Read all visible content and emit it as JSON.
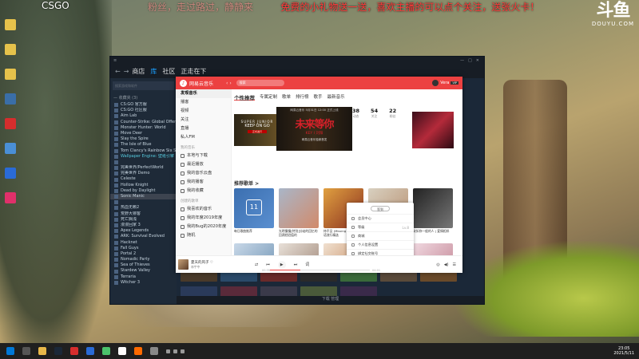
{
  "overlay": {
    "game": "CSGO",
    "marquee_faded": "粉丝，走过路过，静静来",
    "marquee": "免费的小礼物送一送，喜欢主播的可以点个关注，送张火卡！",
    "watermark_big": "斗鱼",
    "watermark_small": "DOUYU.COM"
  },
  "desktop_icons": [
    {
      "label": "",
      "color": "#e6c24b"
    },
    {
      "label": "",
      "color": "#e6c24b"
    },
    {
      "label": "",
      "color": "#e6c24b"
    },
    {
      "label": "",
      "color": "#3a6ea8"
    },
    {
      "label": "",
      "color": "#d62d2d"
    },
    {
      "label": "",
      "color": "#4a8fd6"
    },
    {
      "label": "",
      "color": "#2a6bd6"
    },
    {
      "label": "",
      "color": "#e0306a"
    }
  ],
  "steam": {
    "nav_items": [
      "商店",
      "库",
      "社区",
      "正走在下"
    ],
    "search_placeholder": "搜索游戏和软件",
    "group_label": "— 收藏夹 (3)",
    "games": [
      "CS:GO 官方服",
      "CS:GO 社区服",
      "Aim Lab",
      "Counter-Strike: Global Offensive",
      "Monster Hunter: World",
      "Move Deer",
      "Slay the Spire",
      "The Isle of Blue",
      "Tom Clancy's Rainbow Six Siege",
      "Wallpaper Engine: 壁纸引擎",
      "",
      "完美世界/PerfectWorld",
      "完美世界 Demo",
      "Celeste",
      "Hollow Knight",
      "Dead by Daylight",
      "Sonic Manic",
      "",
      "热血无赖2",
      "荒野大镖客",
      "死亡搁浅",
      "漫漫回家 3",
      "Apex Legends",
      "ARK: Survival Evolved",
      "Hacknet",
      "Fall Guys",
      "Portal 2",
      "Nomadic Party",
      "Sea of Thieves",
      "Stardew Valley",
      "Terraria",
      "Witcher 3"
    ],
    "bottom_text": "下载\n管理"
  },
  "netease": {
    "app_name": "网易云音乐",
    "search_placeholder": "搜索",
    "username": "Vera",
    "vip_badge": "VIP",
    "sidebar": {
      "items": [
        "发现音乐",
        "播客",
        "视频",
        "关注",
        "直播",
        "私人FM"
      ],
      "section_my": "我的音乐",
      "my_items": [
        "本地与下载",
        "最近播放",
        "我的音乐云盘",
        "我的播客",
        "我的收藏"
      ],
      "section_playlist": "创建的歌单",
      "playlist_items": [
        "我喜欢的音乐",
        "我的年度2019年度",
        "我的Bug的2020年度",
        "随机"
      ]
    },
    "tabs": [
      "个性推荐",
      "专属定制",
      "歌单",
      "排行榜",
      "歌手",
      "最新音乐"
    ],
    "banner": {
      "left_line1": "SUPER JUNIOR",
      "left_line2": "KEEP ON GO",
      "left_line3": "正式发行",
      "center_top": "网易云音乐 5月31日 12:00 正式上线",
      "center_big": "未来等你",
      "center_sub": "KEY I 刘阳",
      "center_bottom": "网易云音乐独家首发"
    },
    "stats": [
      {
        "n": "38",
        "l": "动态"
      },
      {
        "n": "54",
        "l": "关注"
      },
      {
        "n": "22",
        "l": "粉丝"
      }
    ],
    "menu": {
      "signin": "签到",
      "items": [
        {
          "label": "会员中心",
          "value": ""
        },
        {
          "label": "等级",
          "value": "Lv.8"
        },
        {
          "label": "商城",
          "value": ""
        },
        {
          "label": "个人信息设置",
          "value": ""
        },
        {
          "label": "绑定社交账号",
          "value": ""
        },
        {
          "label": "我的客服",
          "value": ""
        },
        {
          "label": "退出登录",
          "value": ""
        }
      ]
    },
    "section_title": "推荐歌单 >",
    "playlists": [
      {
        "caption": "每日歌曲推荐",
        "c1": "#3b6fb0",
        "c2": "#5a8fd0",
        "day": "11"
      },
      {
        "caption": "光明慢慢[特别]分歧的回忆的回溯经验值的",
        "c1": "#a9b6c8",
        "c2": "#d28a6a",
        "day": ""
      },
      {
        "caption": "待不见 (Missing Lights) 华语流行精选",
        "c1": "#e0a040",
        "c2": "#8a3020",
        "day": ""
      },
      {
        "caption": "4所有被遗忘的 | 每一首都是你的回忆",
        "c1": "#d8d0c0",
        "c2": "#b89070",
        "day": ""
      },
      {
        "caption": "致如你一般的人 | 爱情相伴",
        "c1": "#222222",
        "c2": "#777777",
        "day": ""
      },
      {
        "caption": "",
        "c1": "#c8d8e8",
        "c2": "#6a8fb0",
        "day": ""
      },
      {
        "caption": "",
        "c1": "#e8e0d8",
        "c2": "#9a8070",
        "day": ""
      },
      {
        "caption": "",
        "c1": "#f0e0d0",
        "c2": "#c08050",
        "day": ""
      },
      {
        "caption": "",
        "c1": "#a0d0e0",
        "c2": "#ffffff",
        "day": ""
      },
      {
        "caption": "",
        "c1": "#f0d8e0",
        "c2": "#c08090",
        "day": ""
      }
    ],
    "player": {
      "song": "夏天的风子 ♡",
      "artist": "林宇中",
      "time_cur": "00:35",
      "time_total": "04:01"
    }
  },
  "taskbar": {
    "icons": [
      "#0078d7",
      "#555555",
      "#e8b84a",
      "#1b2838",
      "#d62d2d",
      "#2a6bd6",
      "#4ac26b",
      "#ffffff",
      "#ff6a00",
      "#888888"
    ],
    "time": "23:05",
    "date": "2021/5/11"
  }
}
